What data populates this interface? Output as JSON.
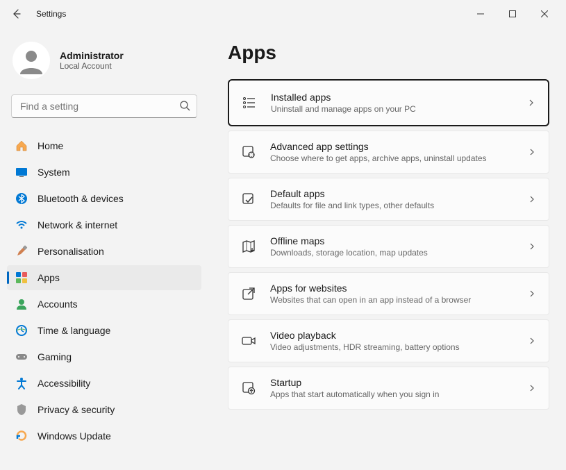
{
  "window": {
    "title": "Settings"
  },
  "profile": {
    "name": "Administrator",
    "sub": "Local Account"
  },
  "search": {
    "placeholder": "Find a setting"
  },
  "sidebar": {
    "items": [
      {
        "label": "Home"
      },
      {
        "label": "System"
      },
      {
        "label": "Bluetooth & devices"
      },
      {
        "label": "Network & internet"
      },
      {
        "label": "Personalisation"
      },
      {
        "label": "Apps"
      },
      {
        "label": "Accounts"
      },
      {
        "label": "Time & language"
      },
      {
        "label": "Gaming"
      },
      {
        "label": "Accessibility"
      },
      {
        "label": "Privacy & security"
      },
      {
        "label": "Windows Update"
      }
    ]
  },
  "page": {
    "title": "Apps"
  },
  "cards": [
    {
      "title": "Installed apps",
      "sub": "Uninstall and manage apps on your PC"
    },
    {
      "title": "Advanced app settings",
      "sub": "Choose where to get apps, archive apps, uninstall updates"
    },
    {
      "title": "Default apps",
      "sub": "Defaults for file and link types, other defaults"
    },
    {
      "title": "Offline maps",
      "sub": "Downloads, storage location, map updates"
    },
    {
      "title": "Apps for websites",
      "sub": "Websites that can open in an app instead of a browser"
    },
    {
      "title": "Video playback",
      "sub": "Video adjustments, HDR streaming, battery options"
    },
    {
      "title": "Startup",
      "sub": "Apps that start automatically when you sign in"
    }
  ]
}
